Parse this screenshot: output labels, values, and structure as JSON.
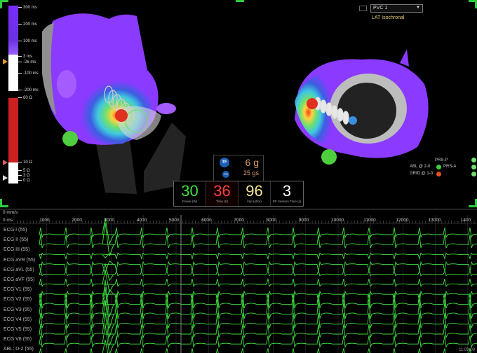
{
  "scale": {
    "ticks": [
      "300 ms",
      "200 ms",
      "100 ms",
      "3 ms",
      "-26 ms",
      "-100 ms",
      "-200 ms",
      "60 Ω",
      "10 Ω",
      "5 Ω",
      "3 Ω",
      "0 Ω"
    ],
    "colors": {
      "lat_top": "#7a2cff",
      "lat_bottom": "#ffffff",
      "impedance": "#cc1f1f"
    }
  },
  "map_selector": {
    "value": "PVC 1",
    "subtitle": "LAT Isochronal"
  },
  "legend": {
    "prs_p": "PRS-P",
    "prs_a": "PRS-A",
    "abl": "ABL @ 2-0",
    "grid": "GRID @ 1-0"
  },
  "ablation": {
    "tf_icon": "TF",
    "fb_icon": "PO",
    "force": "6 g",
    "force_sub": "25 gs",
    "cells": [
      {
        "value": "30",
        "label": "Power (W)",
        "color": "#3ee03e"
      },
      {
        "value": "36",
        "label": "Time (S)",
        "color": "#ff4040"
      },
      {
        "value": "96",
        "label": "Imp (ohm)",
        "color": "#f2e49a"
      },
      {
        "value": "3",
        "label": "RF Session Time (s)",
        "color": "#ffffff"
      }
    ]
  },
  "ecg": {
    "ruler_unit": "0 ms",
    "ruler_header": "0 mm/s",
    "ruler_ticks": [
      "1000",
      "2000",
      "3000",
      "4000",
      "5000",
      "6000",
      "7000",
      "8000",
      "9000",
      "10000",
      "11000",
      "12000",
      "13000",
      "1400"
    ],
    "leads": [
      "ECG I (55)",
      "ECG II (55)",
      "ECG III (55)",
      "ECG aVR (55)",
      "ECG aVL (55)",
      "ECG aVF (55)",
      "ECG V1 (55)",
      "ECG V2 (55)",
      "ECG V3 (55)",
      "ECG V4 (55)",
      "ECG V5 (55)",
      "ECG V6 (55)",
      "ABL: D-2 (55)"
    ],
    "trace_color": "#3fe03f",
    "clock": "11:09:09"
  }
}
